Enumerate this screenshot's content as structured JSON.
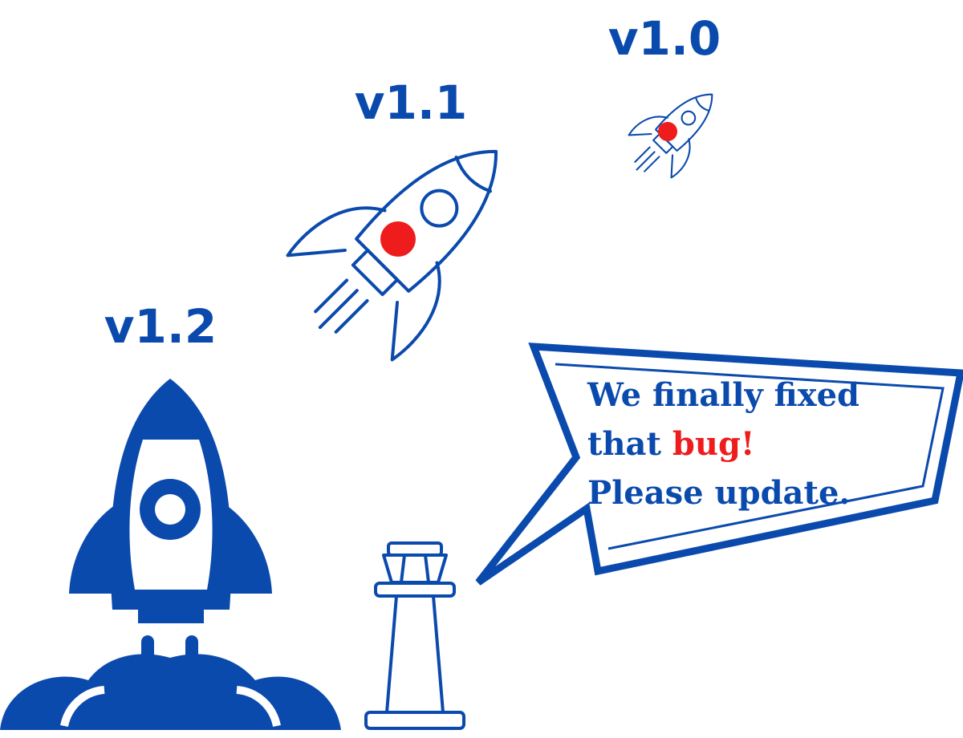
{
  "versions": {
    "old": "v1.0",
    "middle": "v1.1",
    "latest": "v1.2"
  },
  "speech": {
    "line1": "We finally fixed",
    "line2_prefix": "that ",
    "line2_highlight": "bug!",
    "line3": "Please update."
  },
  "colors": {
    "primary": "#0b4aad",
    "accent": "#ee1c1c",
    "background": "#ffffff"
  },
  "icons": [
    "rocket-icon",
    "rocket-launch-icon",
    "control-tower-icon",
    "speech-bubble-icon"
  ]
}
